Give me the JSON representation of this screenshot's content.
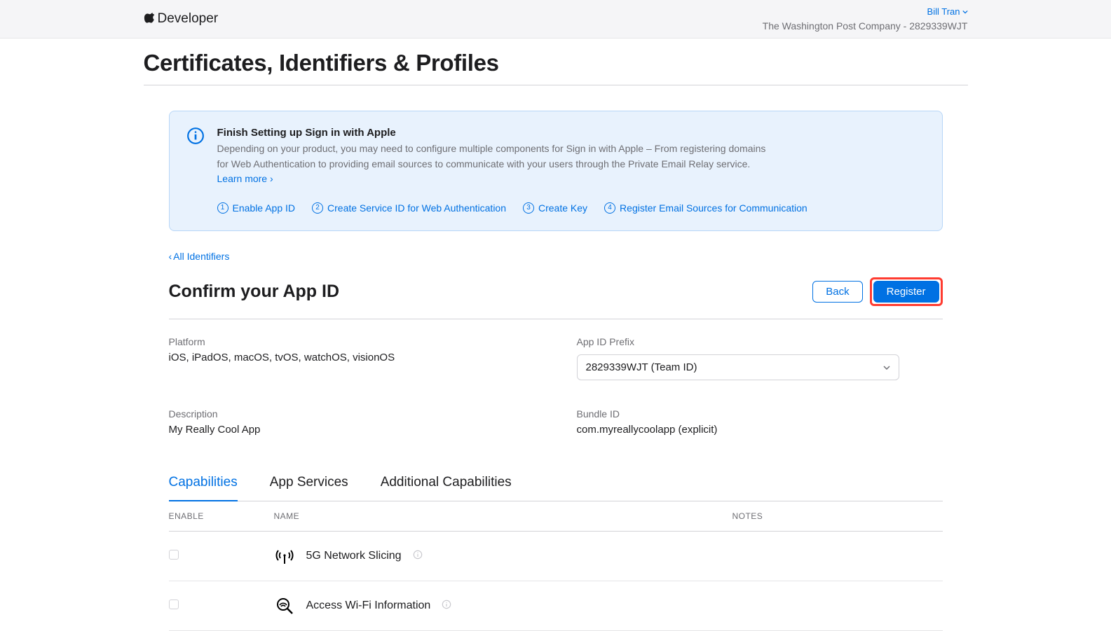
{
  "header": {
    "logo_text": "Developer",
    "user_name": "Bill Tran",
    "team_line": "The Washington Post Company - 2829339WJT"
  },
  "page_title": "Certificates, Identifiers & Profiles",
  "info_panel": {
    "title": "Finish Setting up Sign in with Apple",
    "desc": "Depending on your product, you may need to configure multiple components for Sign in with Apple – From registering domains for Web Authentication to providing email sources to communicate with your users through the Private Email Relay service.",
    "learn_more": "Learn more ›",
    "steps": [
      "Enable App ID",
      "Create Service ID for Web Authentication",
      "Create Key",
      "Register Email Sources for Communication"
    ]
  },
  "back_link": "All Identifiers",
  "section": {
    "title": "Confirm your App ID",
    "back_btn": "Back",
    "register_btn": "Register"
  },
  "fields": {
    "platform_label": "Platform",
    "platform_value": "iOS, iPadOS, macOS, tvOS, watchOS, visionOS",
    "prefix_label": "App ID Prefix",
    "prefix_value": "2829339WJT (Team ID)",
    "description_label": "Description",
    "description_value": "My Really Cool App",
    "bundle_label": "Bundle ID",
    "bundle_value": "com.myreallycoolapp (explicit)"
  },
  "tabs": [
    "Capabilities",
    "App Services",
    "Additional Capabilities"
  ],
  "table_headers": {
    "enable": "ENABLE",
    "name": "NAME",
    "notes": "NOTES"
  },
  "capabilities": [
    {
      "name": "5G Network Slicing",
      "enabled": false
    },
    {
      "name": "Access Wi-Fi Information",
      "enabled": false
    }
  ]
}
